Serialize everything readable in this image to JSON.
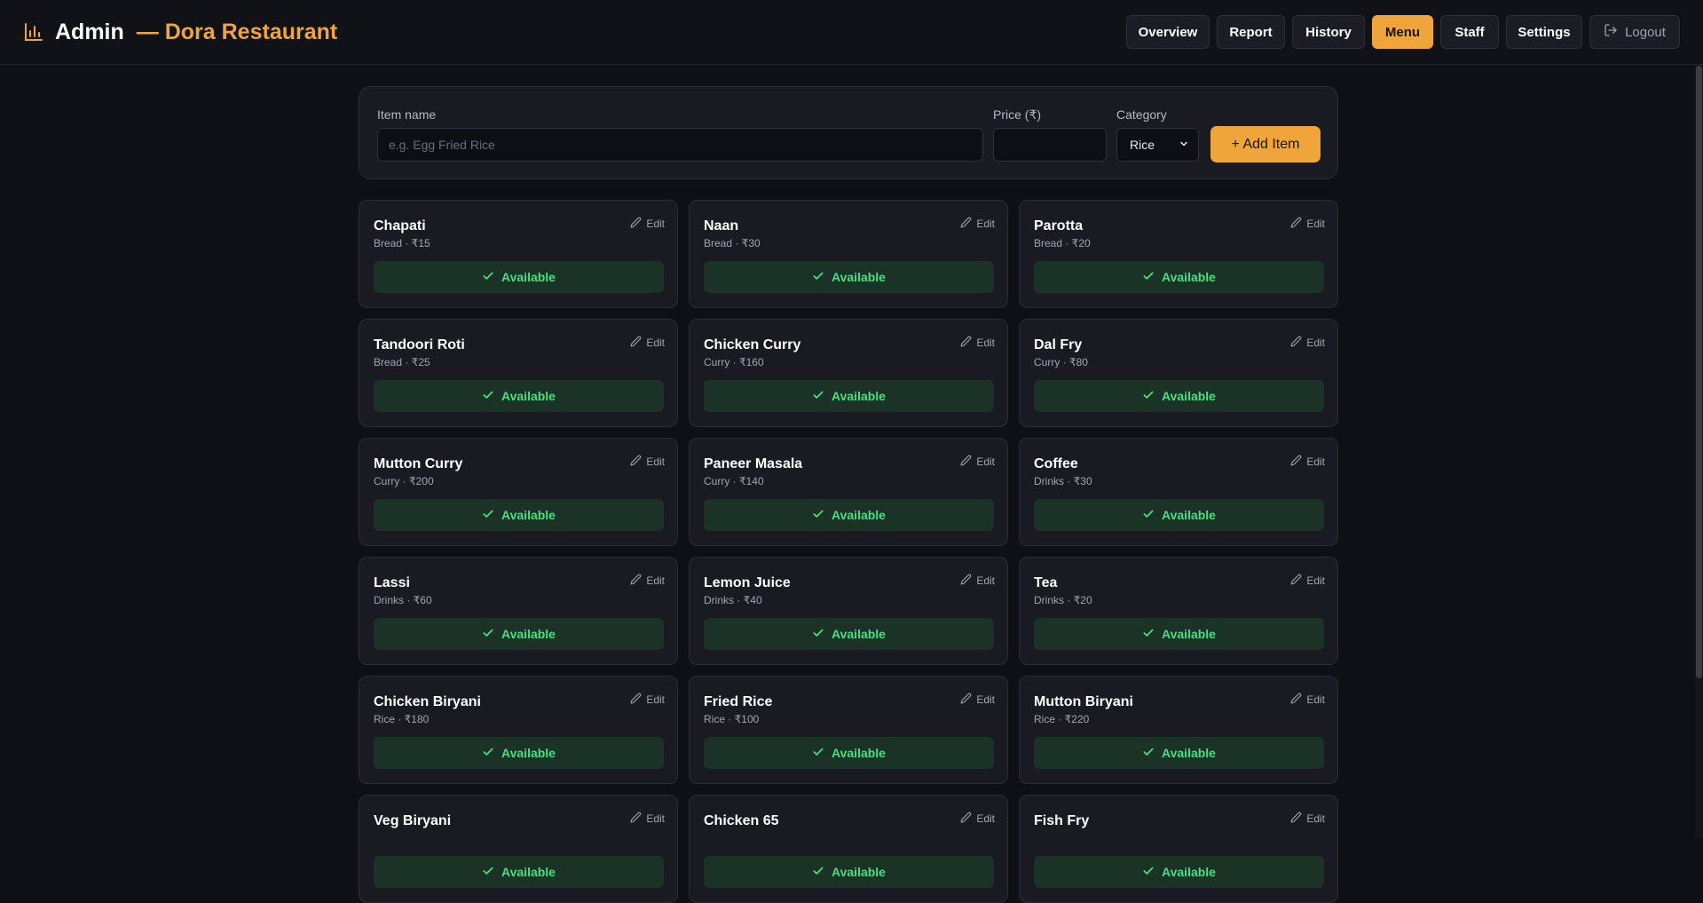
{
  "header": {
    "title": "Admin",
    "subtitle": "— Dora Restaurant",
    "nav": [
      {
        "id": "overview",
        "label": "Overview"
      },
      {
        "id": "report",
        "label": "Report"
      },
      {
        "id": "history",
        "label": "History"
      },
      {
        "id": "menu",
        "label": "Menu",
        "active": true
      },
      {
        "id": "staff",
        "label": "Staff"
      },
      {
        "id": "settings",
        "label": "Settings"
      }
    ],
    "logout_label": "Logout"
  },
  "form": {
    "name_label": "Item name",
    "name_placeholder": "e.g. Egg Fried Rice",
    "name_value": "",
    "price_label": "Price (₹)",
    "price_value": "",
    "category_label": "Category",
    "category_value": "Rice",
    "add_label": "+ Add Item"
  },
  "edit_label": "Edit",
  "available_label": "Available",
  "items": [
    {
      "name": "Chapati",
      "meta": "Bread · ₹15"
    },
    {
      "name": "Naan",
      "meta": "Bread · ₹30"
    },
    {
      "name": "Parotta",
      "meta": "Bread · ₹20"
    },
    {
      "name": "Tandoori Roti",
      "meta": "Bread · ₹25"
    },
    {
      "name": "Chicken Curry",
      "meta": "Curry · ₹160"
    },
    {
      "name": "Dal Fry",
      "meta": "Curry · ₹80"
    },
    {
      "name": "Mutton Curry",
      "meta": "Curry · ₹200"
    },
    {
      "name": "Paneer Masala",
      "meta": "Curry · ₹140"
    },
    {
      "name": "Coffee",
      "meta": "Drinks · ₹30"
    },
    {
      "name": "Lassi",
      "meta": "Drinks · ₹60"
    },
    {
      "name": "Lemon Juice",
      "meta": "Drinks · ₹40"
    },
    {
      "name": "Tea",
      "meta": "Drinks · ₹20"
    },
    {
      "name": "Chicken Biryani",
      "meta": "Rice · ₹180"
    },
    {
      "name": "Fried Rice",
      "meta": "Rice · ₹100"
    },
    {
      "name": "Mutton Biryani",
      "meta": "Rice · ₹220"
    },
    {
      "name": "Veg Biryani",
      "meta": ""
    },
    {
      "name": "Chicken 65",
      "meta": ""
    },
    {
      "name": "Fish Fry",
      "meta": ""
    }
  ],
  "colors": {
    "accent": "#f0a53a",
    "available_text": "#4ade80",
    "available_bg": "#1b3327"
  }
}
